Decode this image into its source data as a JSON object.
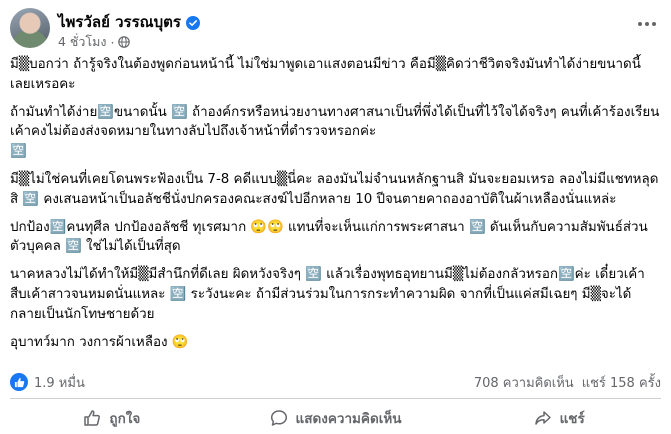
{
  "post": {
    "author": "ไพรวัลย์ วรรณบุตร",
    "time": "4 ชั่วโมง",
    "paragraphs": [
      "มี▒บอกว่า ถ้ารู้จริงในต้องพูดก่อนหน้านี้ ไม่ใช่มาพูดเอาแสงตอนมีข่าว คือมี▒คิดว่าชีวิตจริงมันทำได้ง่ายขนาดนี้เลยเหรอคะ",
      "ถ้ามันทำได้ง่าย🈳ขนาดนั้น 🈳 ถ้าองค์กรหรือหน่วยงานทางศาสนาเป็นที่พึ่งได้เป็นที่ไว้ใจได้จริงๆ คนที่เค้าร้องเรียนเค้าคงไม่ต้องส่งจดหมายในทางลับไปถึงเจ้าหน้าที่ตำรวจหรอกค่ะ\n🈳",
      "มี▒ไม่ใช่คนที่เคยโดนพระฟ้องเป็น 7-8 คดีแบบ▒นี่คะ ลองมันไม่จำนนหลักฐานสิ มันจะยอมเหรอ ลองไม่มีแชทหลุดสิ 🈳 คงเสนอหน้าเป็นอลัชชีนั่งปกครองคณะสงฆ์ไปอีกหลาย 10 ปีจนตายคาถองอาบัติในผ้าเหลืองนั่นแหล่ะ",
      "ปกป้อง🈳คนทุศีล ปกป้องอลัชชี ทุเรศมาก 🙄🙄 แทนที่จะเห็นแก่การพระศาสนา 🈳 ดันเห็นกับความสัมพันธ์ส่วนตัวบุคคล 🈳 ใช่ไม่ได้เป็นที่สุด",
      "นาคหลวงไม่ได้ทำให้มี▒มีสำนึกที่ดีเลย ผิดหวังจริงๆ 🈳 แล้วเรื่องพุทธอุทยานมี▒ไม่ต้องกลัวหรอก🈳ค่ะ เดี๋ยวเค้าสืบเค้าสาวจนหมดนั่นแหละ 🈳 ระวังนะคะ ถ้ามีส่วนร่วมในการกระทำความผิด จากที่เป็นแค่สมีเฉยๆ มี▒จะได้กลายเป็นนักโทษชายด้วย",
      "อุบาทว์มาก วงการผ้าเหลือง 🙄"
    ]
  },
  "stats": {
    "reactions": "1.9 หมื่น",
    "comments": "708 ความคิดเห็น",
    "shares": "แชร์ 158 ครั้ง"
  },
  "actions": {
    "like": "ถูกใจ",
    "comment": "แสดงความคิดเห็น",
    "share": "แชร์"
  },
  "colors": {
    "accent": "#1877f2",
    "muted": "#65676b"
  }
}
